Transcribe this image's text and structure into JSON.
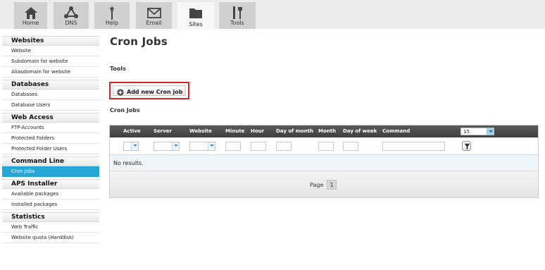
{
  "nav": {
    "tabs": [
      {
        "label": "Home",
        "icon": "home-icon"
      },
      {
        "label": "DNS",
        "icon": "network-icon"
      },
      {
        "label": "Help",
        "icon": "help-wand-icon"
      },
      {
        "label": "Email",
        "icon": "envelope-icon"
      },
      {
        "label": "Sites",
        "icon": "folder-icon",
        "active": true
      },
      {
        "label": "Tools",
        "icon": "tools-icon"
      }
    ]
  },
  "sidebar": {
    "sections": [
      {
        "title": "Websites",
        "items": [
          "Website",
          "Subdomain for website",
          "Aliasdomain for website"
        ]
      },
      {
        "title": "Databases",
        "items": [
          "Databases",
          "Database Users"
        ]
      },
      {
        "title": "Web Access",
        "items": [
          "FTP-Accounts",
          "Protected Folders",
          "Protected Folder Users"
        ]
      },
      {
        "title": "Command Line",
        "items": [
          "Cron Jobs"
        ]
      },
      {
        "title": "APS Installer",
        "items": [
          "Available packages",
          "Installed packages"
        ]
      },
      {
        "title": "Statistics",
        "items": [
          "Web Traffic",
          "Website quota (Harddisk)"
        ]
      }
    ],
    "active_item": "Cron Jobs"
  },
  "main": {
    "title": "Cron Jobs",
    "tools_label": "Tools",
    "add_button_label": "Add new Cron job",
    "list_label": "Cron Jobs",
    "columns": [
      "Active",
      "Server",
      "Website",
      "Minute",
      "Hour",
      "Day of month",
      "Month",
      "Day of week",
      "Command"
    ],
    "page_size": "15",
    "empty_message": "No results.",
    "pager_label": "Page",
    "current_page": "1"
  },
  "colors": {
    "accent": "#27a7d8",
    "highlight_border": "#d9262b",
    "grid_header": "#4a4a4a"
  }
}
